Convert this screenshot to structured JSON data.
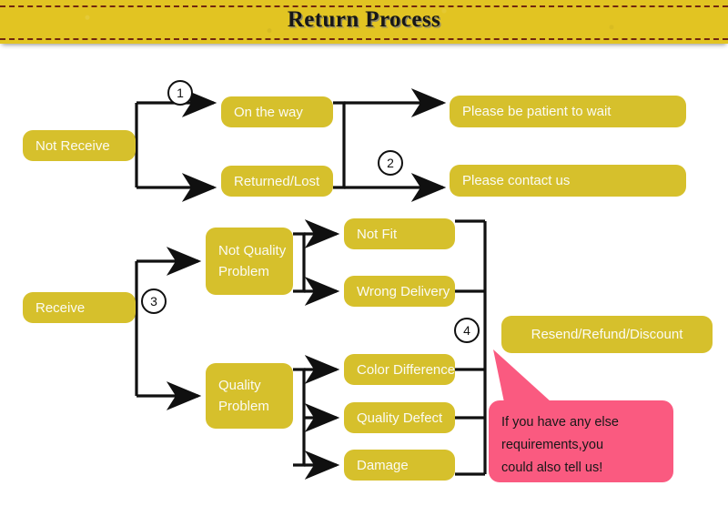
{
  "banner": {
    "title": "Return Process",
    "background_color": "#e2c422",
    "dash_color": "#70270f"
  },
  "theme": {
    "node_color": "#d6c02c",
    "node_text_color": "#fbfbf4",
    "callout_color": "#fa5a80",
    "line_color": "#101010",
    "page_background": "#ffffff"
  },
  "nodes": {
    "not_receive": "Not Receive",
    "on_the_way": "On the way",
    "returned_lost": "Returned/Lost",
    "please_wait": "Please be patient to wait",
    "please_contact": "Please contact us",
    "receive": "Receive",
    "not_quality_problem": "Not Quality Problem",
    "quality_problem": "Quality Problem",
    "not_fit": "Not Fit",
    "wrong_delivery": "Wrong Delivery",
    "color_difference": "Color Difference",
    "quality_defect": "Quality Defect",
    "damage": "Damage",
    "resend_refund_discount": "Resend/Refund/Discount"
  },
  "steps": {
    "one": "1",
    "two": "2",
    "three": "3",
    "four": "4"
  },
  "callout": {
    "line1": "If you have any else",
    "line2": "requirements,you",
    "line3": "could also tell us!"
  }
}
